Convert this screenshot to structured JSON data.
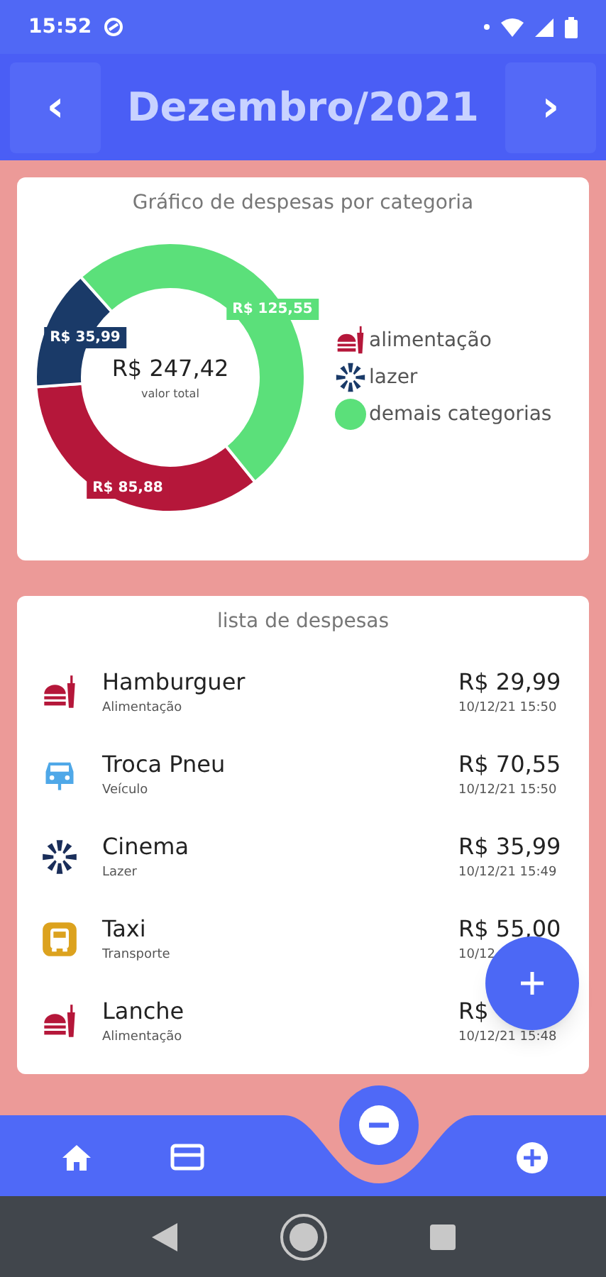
{
  "status_bar": {
    "time": "15:52"
  },
  "header": {
    "title": "Dezembro/2021",
    "prev": "‹",
    "next": "›"
  },
  "chart_card": {
    "title": "Gráfico de despesas por categoria",
    "total": "R$ 247,42",
    "total_caption": "valor total",
    "chart_data": {
      "type": "donut",
      "categories": [
        "alimentação",
        "lazer",
        "demais categorias"
      ],
      "values": [
        85.88,
        35.99,
        125.55
      ],
      "value_labels": [
        "R$ 85,88",
        "R$ 35,99",
        "R$ 125,55"
      ]
    },
    "legend": [
      {
        "kind": "food",
        "color": "#b5173a"
      },
      {
        "kind": "leisure",
        "color": "#1a3a68"
      },
      {
        "kind": "dot",
        "color": "#5be07a"
      }
    ]
  },
  "expenses": {
    "title": "lista de despesas",
    "items": [
      {
        "name": "Hamburguer",
        "category": "Alimentação",
        "amount": "R$ 29,99",
        "date": "10/12/21 15:50",
        "kind": "food",
        "color": "#b5173a"
      },
      {
        "name": "Troca Pneu",
        "category": "Veículo",
        "amount": "R$ 70,55",
        "date": "10/12/21 15:50",
        "kind": "vehicle",
        "color": "#4fa8e8"
      },
      {
        "name": "Cinema",
        "category": "Lazer",
        "amount": "R$ 35,99",
        "date": "10/12/21 15:49",
        "kind": "leisure",
        "color": "#1a2e5a"
      },
      {
        "name": "Taxi",
        "category": "Transporte",
        "amount": "R$ 55,00",
        "date": "10/12",
        "kind": "transport",
        "color": "#dca21e"
      },
      {
        "name": "Lanche",
        "category": "Alimentação",
        "amount": "R$",
        "date": "10/12/21 15:48",
        "kind": "food",
        "color": "#b5173a"
      }
    ]
  }
}
